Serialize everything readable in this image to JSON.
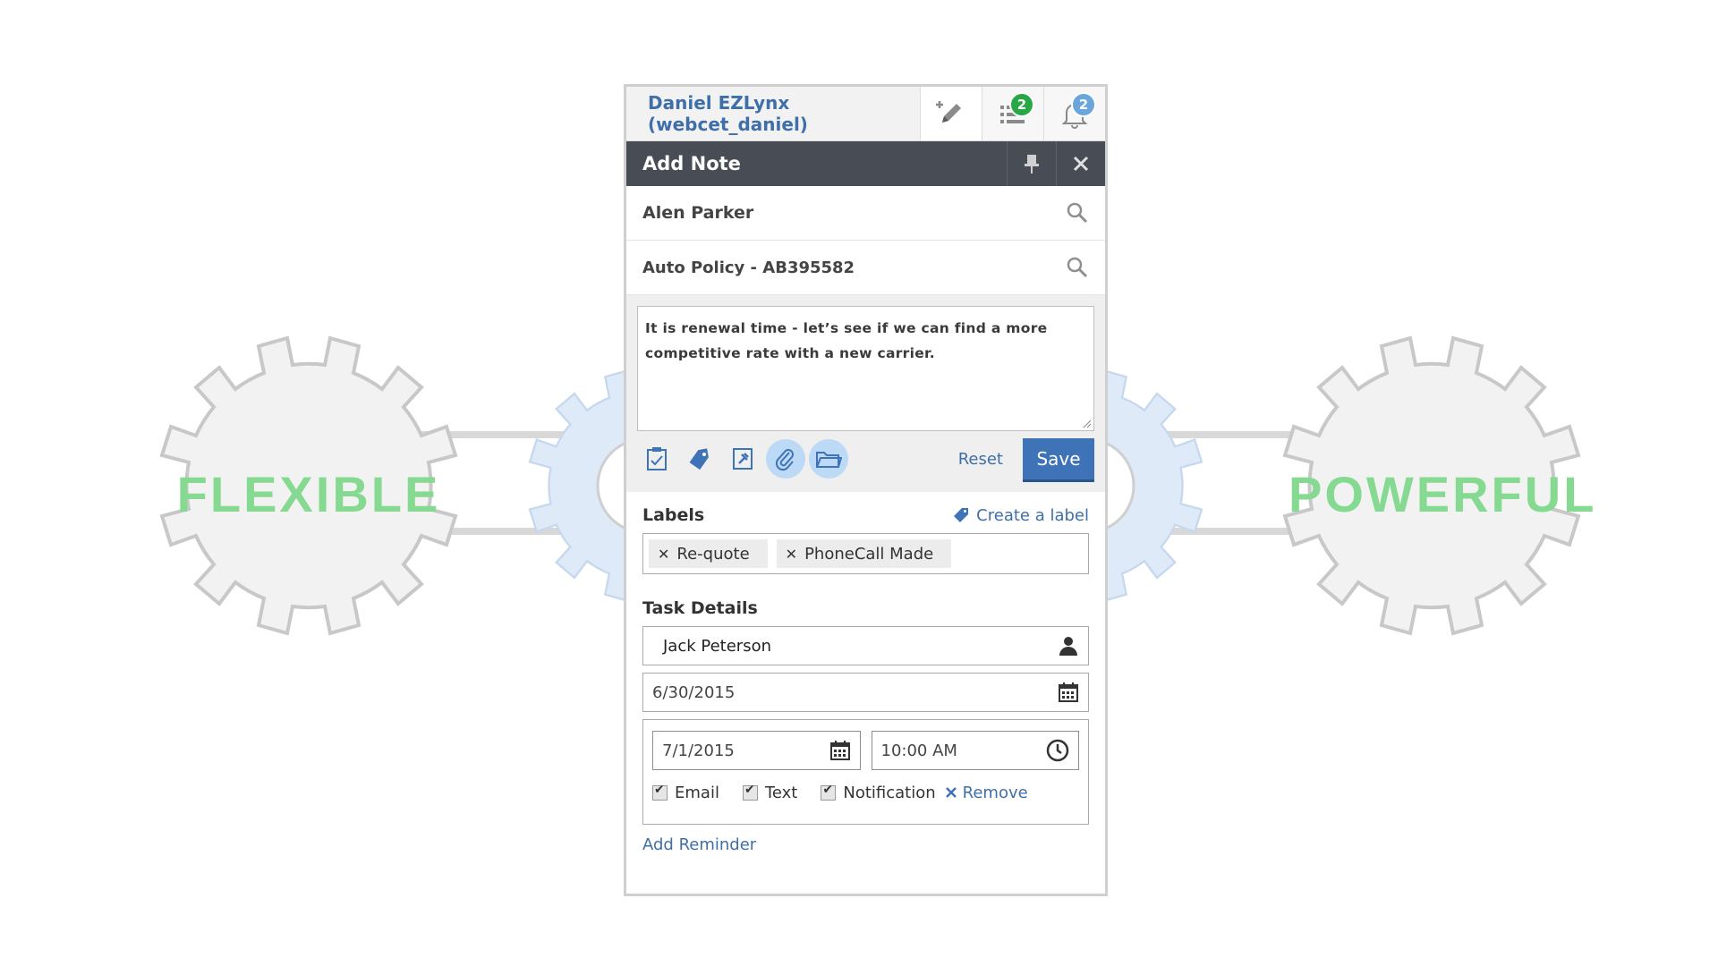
{
  "background": {
    "left_word": "FLEXIBLE",
    "right_word": "POWERFUL",
    "word_color": "#86d990",
    "gear_fill": "#f2f2f2",
    "gear_stroke": "#c8c8c8",
    "blue_gear_fill": "#deeaf8"
  },
  "header": {
    "user_name": "Daniel EZLynx (webcet_daniel)",
    "add_note_icon": "pencil-plus-icon",
    "tasks_icon": "task-list-icon",
    "tasks_badge": "2",
    "tasks_badge_color": "#27a844",
    "notifications_icon": "bell-icon",
    "notifications_badge": "2",
    "notifications_badge_color": "#6aa6dc"
  },
  "dialog": {
    "title": "Add Note",
    "pin_icon": "pin-icon",
    "close_icon": "close-icon"
  },
  "contact": {
    "value": "Alen Parker",
    "icon": "search-icon"
  },
  "policy": {
    "value": "Auto Policy - AB395582",
    "icon": "search-icon"
  },
  "note": {
    "text": "It is renewal time - let’s see if we can find a more competitive rate with a new carrier."
  },
  "toolbar": {
    "tools": [
      "clipboard-check-icon",
      "label-icon",
      "pin-note-icon",
      "paperclip-icon",
      "folder-icon"
    ],
    "reset_label": "Reset",
    "save_label": "Save",
    "accent_color": "#3f73b7"
  },
  "labels": {
    "heading": "Labels",
    "create_label": "Create a label",
    "chips": [
      "Re-quote",
      "PhoneCall Made"
    ]
  },
  "task": {
    "heading": "Task Details",
    "assignee": "Jack Peterson",
    "due_date": "6/30/2015"
  },
  "reminder": {
    "date": "7/1/2015",
    "time": "10:00 AM",
    "options": [
      {
        "label": "Email",
        "checked": true
      },
      {
        "label": "Text",
        "checked": true
      },
      {
        "label": "Notification",
        "checked": true
      }
    ],
    "remove_label": "Remove",
    "add_label": "Add Reminder"
  }
}
